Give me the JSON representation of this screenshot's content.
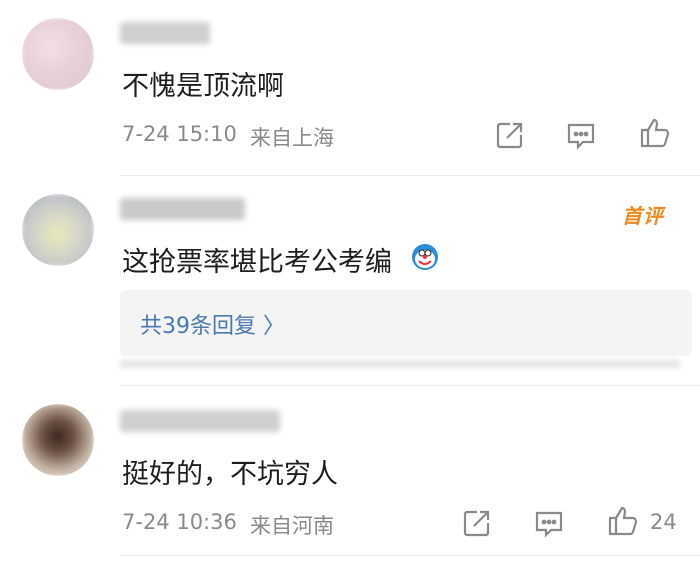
{
  "comments": [
    {
      "text": "不愧是顶流啊",
      "date": "7-24 15:10",
      "location": "来自上海"
    },
    {
      "badge": "首评",
      "text": "这抢票率堪比考公考编",
      "emoji": "doraemon-face",
      "replies_label": "共39条回复 〉"
    },
    {
      "text": "挺好的，不坑穷人",
      "date": "7-24 10:36",
      "location": "来自河南",
      "likes": "24"
    }
  ],
  "colors": {
    "link": "#4a79b0",
    "badge": "#f08a1f",
    "meta": "#8a8a8a"
  },
  "icons": [
    "share-icon",
    "comment-icon",
    "like-icon"
  ]
}
